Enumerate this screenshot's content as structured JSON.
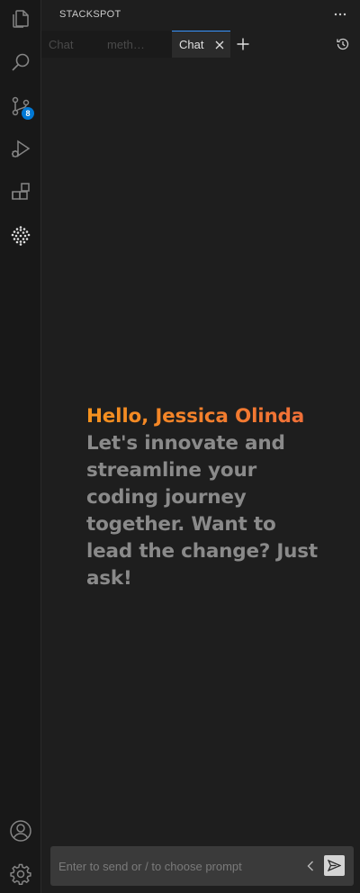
{
  "activity_bar": {
    "items": [
      {
        "icon": "files-icon"
      },
      {
        "icon": "search-icon"
      },
      {
        "icon": "source-control-icon",
        "badge": "8"
      },
      {
        "icon": "run-debug-icon"
      },
      {
        "icon": "extensions-icon"
      },
      {
        "icon": "stackspot-icon"
      }
    ],
    "bottom": [
      {
        "icon": "account-icon"
      },
      {
        "icon": "settings-gear-icon"
      }
    ]
  },
  "panel": {
    "title": "STACKSPOT",
    "more_icon": "ellipsis-icon",
    "tabs": [
      {
        "label": "Chat",
        "active": false
      },
      {
        "label": "meth…",
        "active": false
      },
      {
        "label": "Chat",
        "active": true
      }
    ],
    "add_tab_icon": "plus-icon",
    "history_icon": "history-icon"
  },
  "welcome": {
    "greeting": "Hello, Jessica Olinda",
    "tagline": "Let's innovate and streamline your coding journey together. Want to lead the change? Just ask!"
  },
  "prompt": {
    "placeholder": "Enter to send or / to choose prompt",
    "value": ""
  },
  "colors": {
    "greeting_start": "#f5921e",
    "greeting_end": "#f06d3a",
    "badge": "#0078d4",
    "active_tab_accent": "#3794ff"
  }
}
